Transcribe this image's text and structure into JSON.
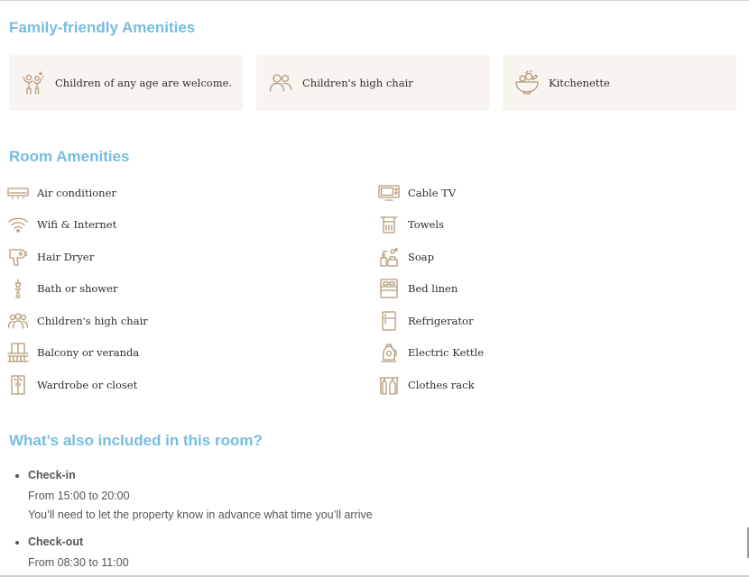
{
  "sections": {
    "family_title": "Family-friendly Amenities",
    "room_title": "Room Amenities",
    "included_title": "What’s also included in this room?"
  },
  "family_cards": [
    {
      "label": "Children of any age are welcome.",
      "icon": "children-icon"
    },
    {
      "label": "Children's high chair",
      "icon": "people-icon"
    },
    {
      "label": "Kitchenette",
      "icon": "kitchen-bowl-icon"
    }
  ],
  "room_amenities": {
    "left": [
      {
        "label": "Air conditioner",
        "icon": "air-conditioner-icon"
      },
      {
        "label": "Wifi & Internet",
        "icon": "wifi-icon"
      },
      {
        "label": "Hair Dryer",
        "icon": "hair-dryer-icon"
      },
      {
        "label": "Bath or shower",
        "icon": "shower-icon"
      },
      {
        "label": "Children's high chair",
        "icon": "people-icon"
      },
      {
        "label": "Balcony or veranda",
        "icon": "balcony-icon"
      },
      {
        "label": "Wardrobe or closet",
        "icon": "wardrobe-icon"
      }
    ],
    "right": [
      {
        "label": "Cable TV",
        "icon": "tv-icon"
      },
      {
        "label": "Towels",
        "icon": "towel-icon"
      },
      {
        "label": "Soap",
        "icon": "soap-icon"
      },
      {
        "label": "Bed linen",
        "icon": "bed-linen-icon"
      },
      {
        "label": "Refrigerator",
        "icon": "refrigerator-icon"
      },
      {
        "label": "Electric Kettle",
        "icon": "kettle-icon"
      },
      {
        "label": "Clothes rack",
        "icon": "clothes-rack-icon"
      }
    ]
  },
  "included": [
    {
      "name": "Check-in",
      "lines": [
        "From 15:00 to 20:00",
        "You’ll need to let the property know in advance what time you’ll arrive"
      ]
    },
    {
      "name": "Check-out",
      "lines": [
        "From 08:30 to 11:00"
      ]
    }
  ],
  "colors": {
    "heading": "#75bde0",
    "icon": "#b49a78",
    "card_bg": "#f8f5f1",
    "text": "#2d2d2d"
  }
}
